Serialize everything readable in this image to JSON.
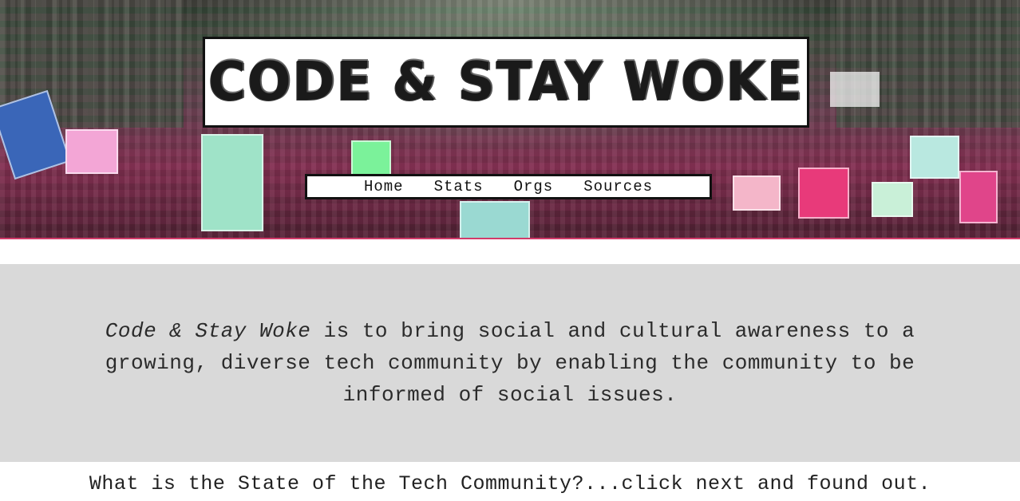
{
  "header": {
    "logo_text": "CODE & STAY WOKE"
  },
  "nav": {
    "items": [
      {
        "label": "Home"
      },
      {
        "label": "Stats"
      },
      {
        "label": "Orgs"
      },
      {
        "label": "Sources"
      }
    ]
  },
  "mission": {
    "brand": "Code & Stay Woke",
    "text": " is to bring social and cultural awareness to a growing, diverse tech community by enabling the community to be informed of social issues."
  },
  "tagline": "What is the State of the Tech Community?...click next and found out.",
  "colors": {
    "mission_bg": "#d9d9d9",
    "hero_accent": "#d23a6a"
  }
}
